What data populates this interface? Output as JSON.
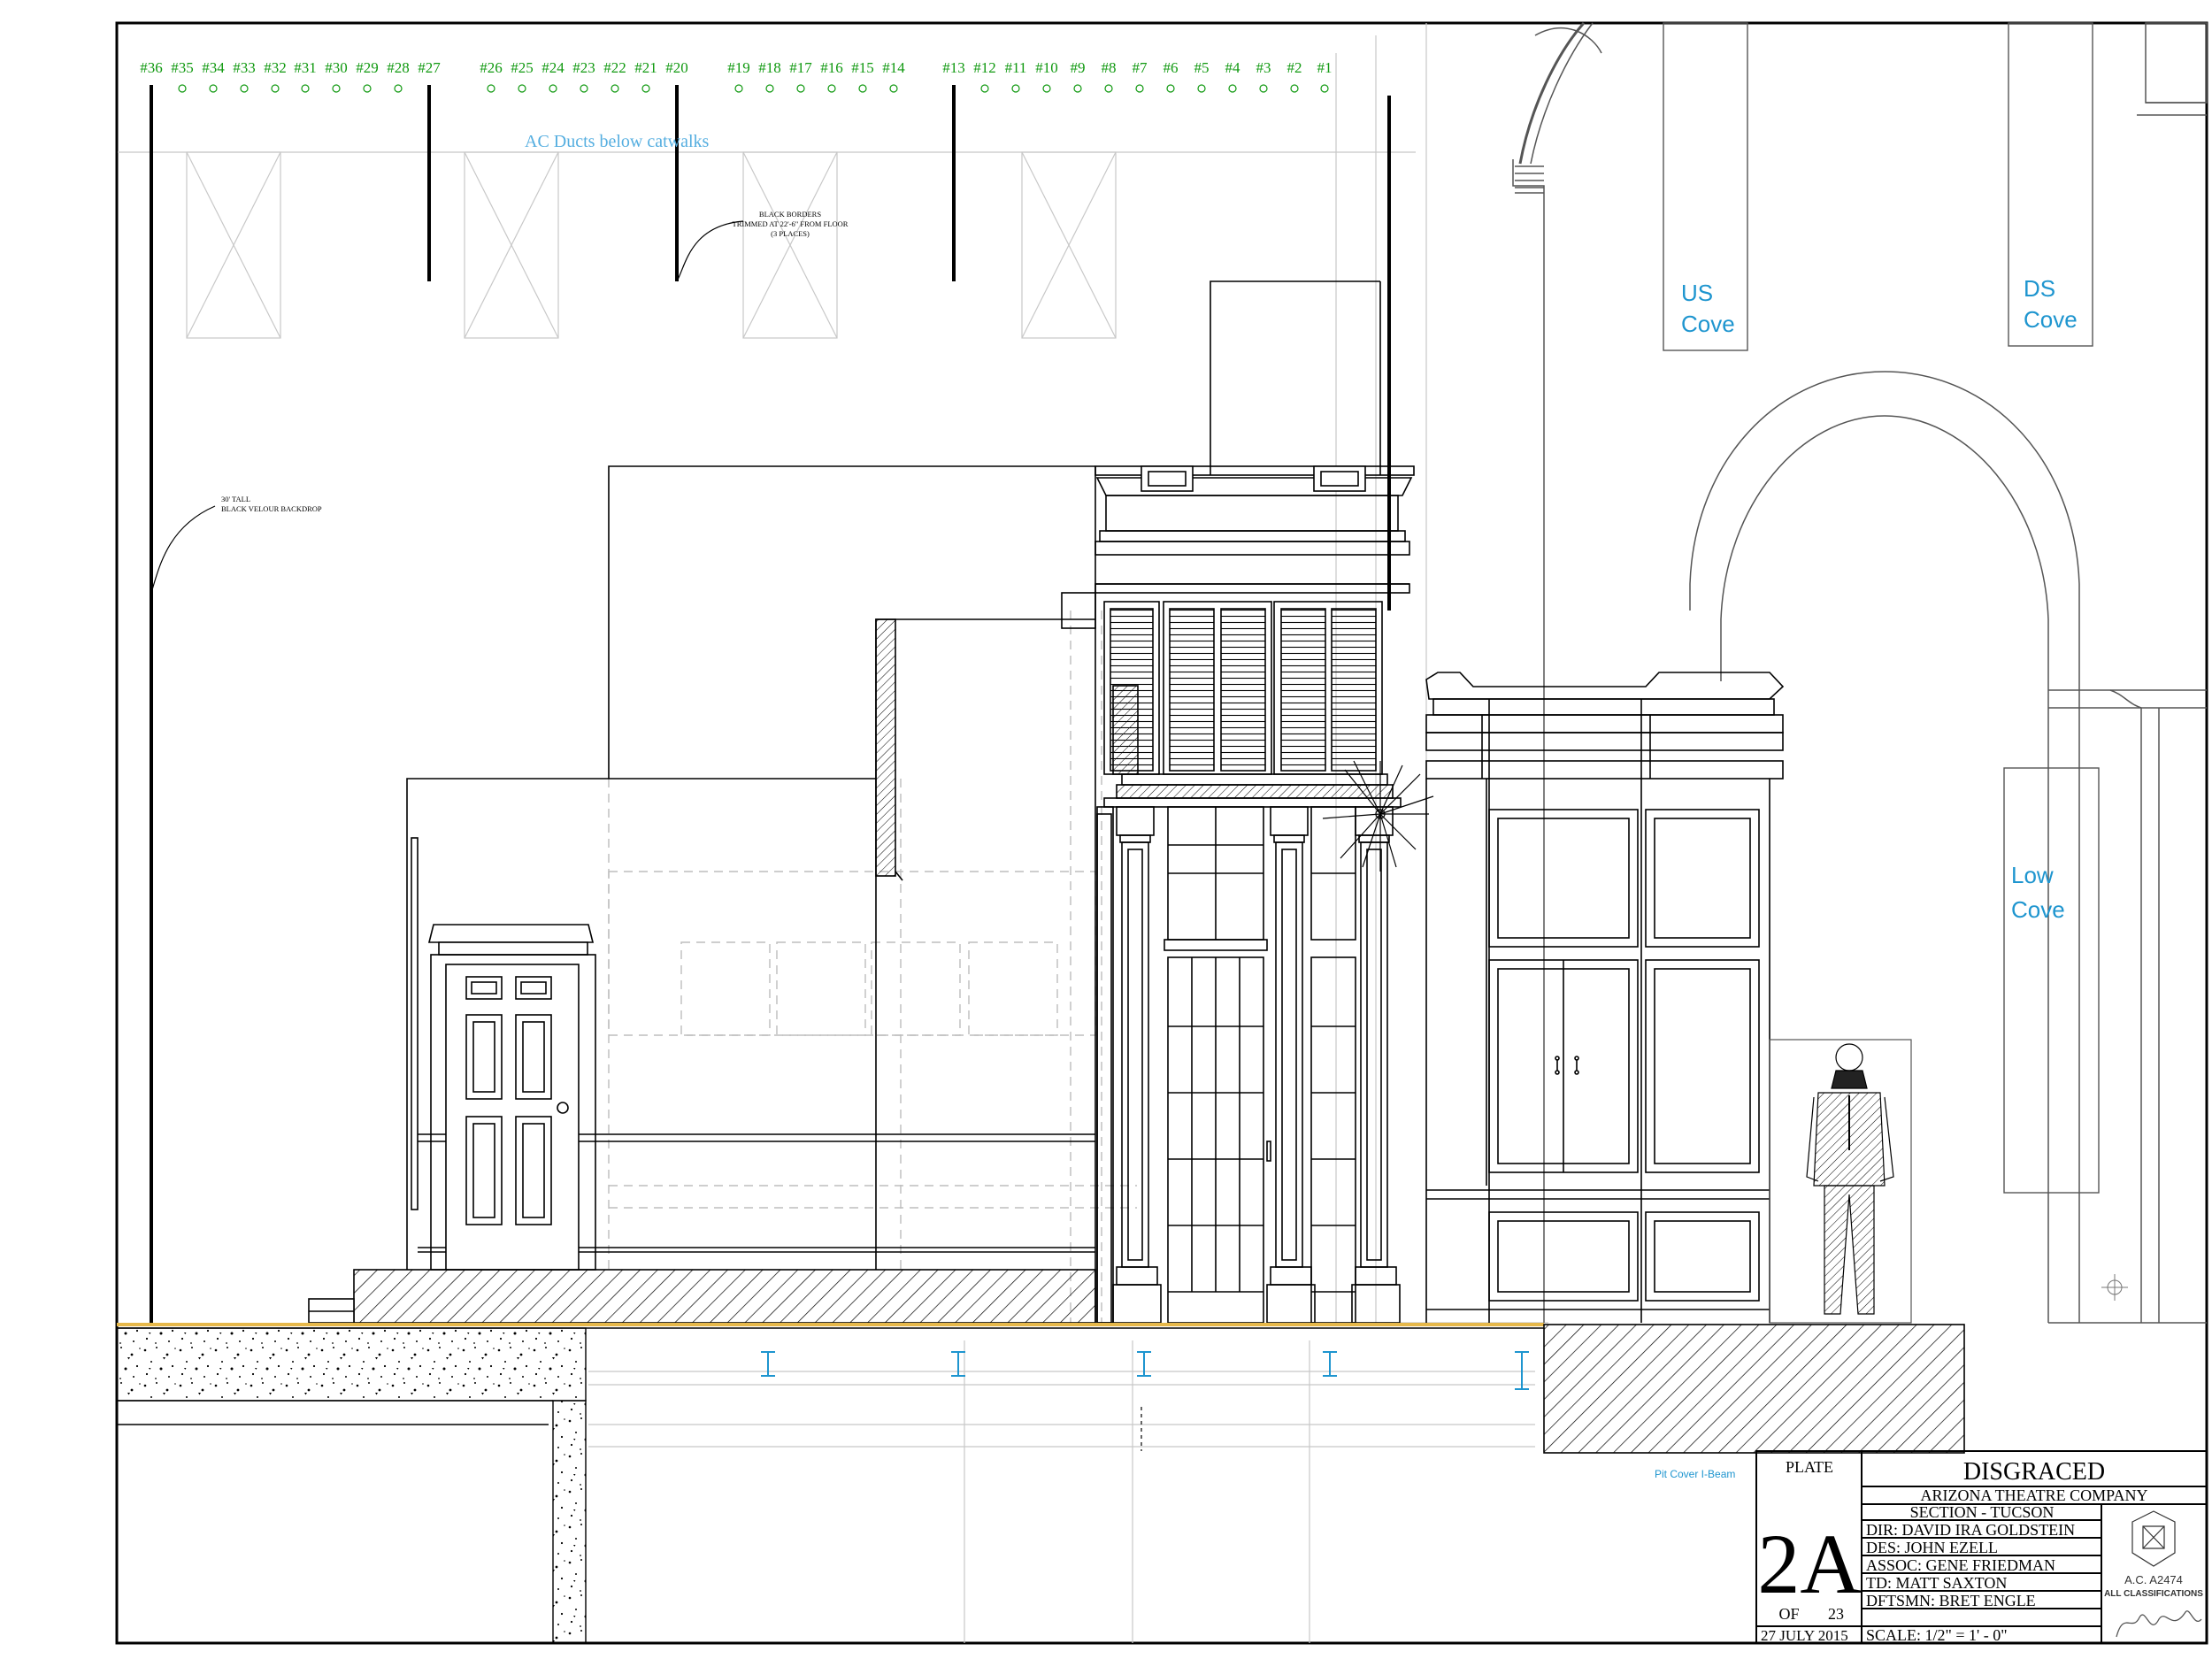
{
  "linesets_left": [
    "#36",
    "#35",
    "#34",
    "#33",
    "#32",
    "#31",
    "#30",
    "#29",
    "#28",
    "#27"
  ],
  "linesets_mid1": [
    "#26",
    "#25",
    "#24",
    "#23",
    "#22",
    "#21",
    "#20"
  ],
  "linesets_mid2": [
    "#19",
    "#18",
    "#17",
    "#16",
    "#15",
    "#14"
  ],
  "linesets_right": [
    "#13",
    "#12",
    "#11",
    "#10",
    "#9",
    "#8",
    "#7",
    "#6",
    "#5",
    "#4",
    "#3",
    "#2",
    "#1"
  ],
  "notes": {
    "ac_ducts": "AC Ducts below catwalks",
    "borders_l1": "BLACK BORDERS",
    "borders_l2": "TRIMMED AT 22'-6\" FROM FLOOR",
    "borders_l3": "(3 PLACES)",
    "backdrop_l1": "30' TALL",
    "backdrop_l2": "BLACK VELOUR BACKDROP",
    "pit_cover": "Pit Cover I-Beam"
  },
  "coves": {
    "us_1": "US",
    "us_2": "Cove",
    "ds_1": "DS",
    "ds_2": "Cove",
    "low_1": "Low",
    "low_2": "Cove"
  },
  "title_block": {
    "plate_label": "PLATE",
    "plate_number": "2A",
    "of_label": "OF",
    "total_plates": "23",
    "date": "27 JULY 2015",
    "show_title": "DISGRACED",
    "company": "ARIZONA THEATRE COMPANY",
    "section": "SECTION - TUCSON",
    "director": "DIR: DAVID IRA GOLDSTEIN",
    "designer": "DES: JOHN EZELL",
    "associate": "ASSOC: GENE FRIEDMAN",
    "td": "TD: MATT SAXTON",
    "draftsman": "DFTSMN: BRET ENGLE",
    "scale": "SCALE: 1/2\" = 1' - 0\"",
    "union_line1": "A.C. A2474",
    "union_line2": "ALL CLASSIFICATIONS"
  },
  "colors": {
    "lineset_green": "#109910",
    "cove_blue": "#1e95cf",
    "floor_yellow": "#e6b84a",
    "line": "#000000"
  }
}
